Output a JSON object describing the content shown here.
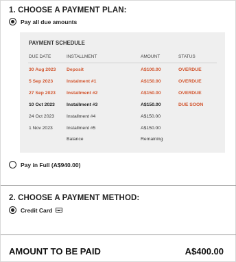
{
  "plan_section": {
    "title": "1. CHOOSE A PAYMENT PLAN:",
    "option_due": {
      "label": "Pay all due amounts",
      "selected": true
    },
    "option_full": {
      "label": "Pay in Full (A$940.00)",
      "selected": false
    }
  },
  "schedule": {
    "title": "PAYMENT SCHEDULE",
    "columns": [
      "DUE DATE",
      "INSTALLMENT",
      "AMOUNT",
      "STATUS"
    ],
    "rows": [
      {
        "date": "30 Aug 2023",
        "installment": "Deposit",
        "amount": "A$100.00",
        "status": "OVERDUE",
        "style": "overdue"
      },
      {
        "date": "5 Sep 2023",
        "installment": "Instalment #1",
        "amount": "A$150.00",
        "status": "OVERDUE",
        "style": "overdue"
      },
      {
        "date": "27 Sep 2023",
        "installment": "Installment #2",
        "amount": "A$150.00",
        "status": "OVERDUE",
        "style": "overdue"
      },
      {
        "date": "10 Oct 2023",
        "installment": "Installment #3",
        "amount": "A$150.00",
        "status": "DUE SOON",
        "style": "soon"
      },
      {
        "date": "24 Oct 2023",
        "installment": "Installment #4",
        "amount": "A$150.00",
        "status": "",
        "style": "normal"
      },
      {
        "date": "1 Nov 2023",
        "installment": "Installment #5",
        "amount": "A$150.00",
        "status": "",
        "style": "normal"
      }
    ],
    "footer": {
      "installment": "Balance",
      "amount": "Remaining"
    }
  },
  "method_section": {
    "title": "2. CHOOSE A PAYMENT METHOD:",
    "option_card": {
      "label": "Credit Card",
      "icon": "credit-card-icon",
      "selected": true
    }
  },
  "total": {
    "label": "AMOUNT TO BE PAID",
    "value": "A$400.00"
  },
  "colors": {
    "accent": "#d2552e",
    "schedule_bg": "#efefef"
  }
}
